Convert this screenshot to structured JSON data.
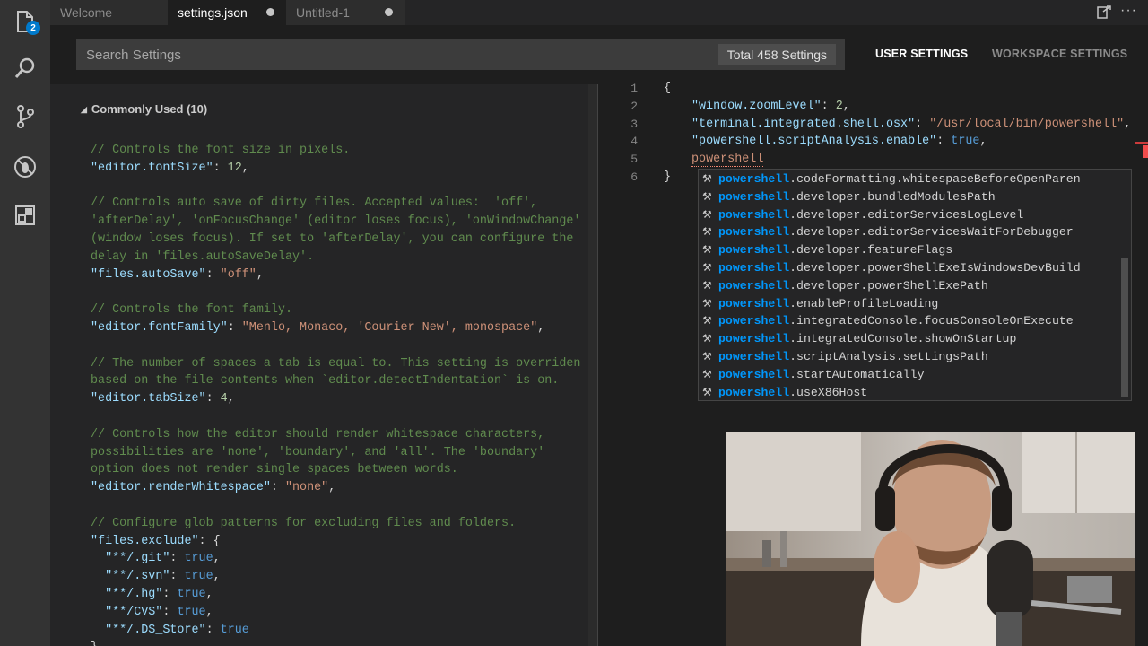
{
  "activity_bar": {
    "explorer_badge": "2",
    "items": [
      "explorer-icon",
      "search-icon",
      "source-control-icon",
      "debug-icon",
      "extensions-icon"
    ]
  },
  "tabs": [
    {
      "label": "Welcome",
      "active": false,
      "dirty": false
    },
    {
      "label": "settings.json",
      "active": true,
      "dirty": true
    },
    {
      "label": "Untitled-1",
      "active": false,
      "dirty": true
    }
  ],
  "search": {
    "placeholder": "Search Settings",
    "count_label": "Total 458 Settings"
  },
  "settings_tabs": {
    "user": "USER SETTINGS",
    "workspace": "WORKSPACE SETTINGS"
  },
  "defaults": {
    "group_header": "Commonly Used (10)",
    "lines": [
      {
        "kind": "comment",
        "text": "// Controls the font size in pixels."
      },
      {
        "kind": "kv",
        "key": "\"editor.fontSize\"",
        "value": "12",
        "vtype": "num",
        "tail": ","
      },
      {
        "kind": "blank"
      },
      {
        "kind": "comment",
        "text": "// Controls auto save of dirty files. Accepted values:  'off',"
      },
      {
        "kind": "comment",
        "text": "'afterDelay', 'onFocusChange' (editor loses focus), 'onWindowChange'"
      },
      {
        "kind": "comment",
        "text": "(window loses focus). If set to 'afterDelay', you can configure the"
      },
      {
        "kind": "comment",
        "text": "delay in 'files.autoSaveDelay'."
      },
      {
        "kind": "kv",
        "key": "\"files.autoSave\"",
        "value": "\"off\"",
        "vtype": "str",
        "tail": ","
      },
      {
        "kind": "blank"
      },
      {
        "kind": "comment",
        "text": "// Controls the font family."
      },
      {
        "kind": "kv",
        "key": "\"editor.fontFamily\"",
        "value": "\"Menlo, Monaco, 'Courier New', monospace\"",
        "vtype": "str",
        "tail": ","
      },
      {
        "kind": "blank"
      },
      {
        "kind": "comment",
        "text": "// The number of spaces a tab is equal to. This setting is overriden"
      },
      {
        "kind": "comment",
        "text": "based on the file contents when `editor.detectIndentation` is on."
      },
      {
        "kind": "kv",
        "key": "\"editor.tabSize\"",
        "value": "4",
        "vtype": "num",
        "tail": ","
      },
      {
        "kind": "blank"
      },
      {
        "kind": "comment",
        "text": "// Controls how the editor should render whitespace characters,"
      },
      {
        "kind": "comment",
        "text": "possibilities are 'none', 'boundary', and 'all'. The 'boundary'"
      },
      {
        "kind": "comment",
        "text": "option does not render single spaces between words."
      },
      {
        "kind": "kv",
        "key": "\"editor.renderWhitespace\"",
        "value": "\"none\"",
        "vtype": "str",
        "tail": ","
      },
      {
        "kind": "blank"
      },
      {
        "kind": "comment",
        "text": "// Configure glob patterns for excluding files and folders."
      },
      {
        "kind": "kv",
        "key": "\"files.exclude\"",
        "value": "{",
        "vtype": "pn",
        "tail": ""
      },
      {
        "kind": "kv",
        "indent": true,
        "key": "\"**/.git\"",
        "value": "true",
        "vtype": "kw",
        "tail": ","
      },
      {
        "kind": "kv",
        "indent": true,
        "key": "\"**/.svn\"",
        "value": "true",
        "vtype": "kw",
        "tail": ","
      },
      {
        "kind": "kv",
        "indent": true,
        "key": "\"**/.hg\"",
        "value": "true",
        "vtype": "kw",
        "tail": ","
      },
      {
        "kind": "kv",
        "indent": true,
        "key": "\"**/CVS\"",
        "value": "true",
        "vtype": "kw",
        "tail": ","
      },
      {
        "kind": "kv",
        "indent": true,
        "key": "\"**/.DS_Store\"",
        "value": "true",
        "vtype": "kw",
        "tail": ""
      },
      {
        "kind": "close",
        "text": "},"
      }
    ]
  },
  "user_settings": {
    "line_numbers": [
      "1",
      "2",
      "3",
      "4",
      "5",
      "6"
    ],
    "lines": [
      {
        "kind": "brace",
        "text": "{"
      },
      {
        "kind": "kv",
        "key": "\"window.zoomLevel\"",
        "value": "2",
        "vtype": "num",
        "tail": ","
      },
      {
        "kind": "kv",
        "key": "\"terminal.integrated.shell.osx\"",
        "value": "\"/usr/local/bin/powershell\"",
        "vtype": "str",
        "tail": ","
      },
      {
        "kind": "kv",
        "key": "\"powershell.scriptAnalysis.enable\"",
        "value": "true",
        "vtype": "kw",
        "tail": ","
      },
      {
        "kind": "typing",
        "text": "powershell"
      },
      {
        "kind": "brace",
        "text": "}"
      }
    ]
  },
  "suggestions": {
    "match": "powershell",
    "items": [
      ".codeFormatting.whitespaceBeforeOpenParen",
      ".developer.bundledModulesPath",
      ".developer.editorServicesLogLevel",
      ".developer.editorServicesWaitForDebugger",
      ".developer.featureFlags",
      ".developer.powerShellExeIsWindowsDevBuild",
      ".developer.powerShellExePath",
      ".enableProfileLoading",
      ".integratedConsole.focusConsoleOnExecute",
      ".integratedConsole.showOnStartup",
      ".scriptAnalysis.settingsPath",
      ".startAutomatically",
      ".useX86Host"
    ]
  },
  "colors": {
    "accent": "#007acc",
    "comment": "#608b4e",
    "key": "#9cdcfe",
    "string": "#ce9178",
    "number": "#b5cea8",
    "keyword": "#569cd6",
    "suggest_match": "#0097fb",
    "error": "#f14c4c"
  }
}
